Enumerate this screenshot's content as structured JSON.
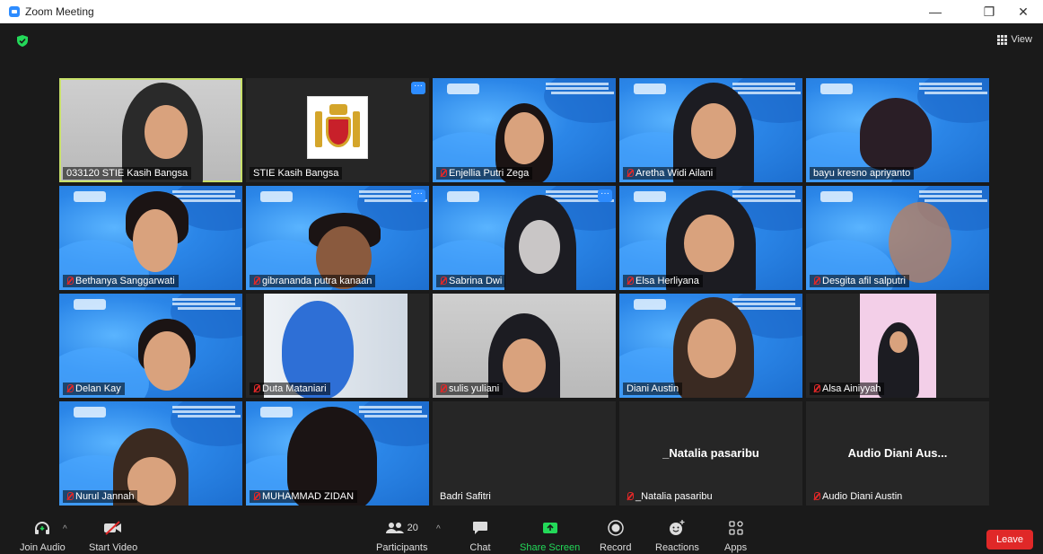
{
  "window": {
    "title": "Zoom Meeting",
    "minimize_glyph": "—",
    "restore_glyph": "❐",
    "close_glyph": "✕"
  },
  "top": {
    "view_label": "View",
    "security_icon": "shield-check-icon"
  },
  "tiles": [
    {
      "name": "033120 STIE Kasih Bangsa",
      "muted": false
    },
    {
      "name": "STIE Kasih Bangsa",
      "muted": false
    },
    {
      "name": "Enjellia Putri Zega",
      "muted": true
    },
    {
      "name": "Aretha Widi Ailani",
      "muted": true
    },
    {
      "name": "bayu kresno apriyanto",
      "muted": false
    },
    {
      "name": "Bethanya Sanggarwati",
      "muted": true
    },
    {
      "name": "gibrananda putra kanaan",
      "muted": true
    },
    {
      "name": "Sabrina Dwi",
      "muted": true
    },
    {
      "name": "Elsa Herliyana",
      "muted": true
    },
    {
      "name": "Desgita afil salputri",
      "muted": true
    },
    {
      "name": "Delan Kay",
      "muted": true
    },
    {
      "name": "Duta Mataniari",
      "muted": true
    },
    {
      "name": "sulis yuliani",
      "muted": true
    },
    {
      "name": "Diani Austin",
      "muted": false
    },
    {
      "name": "Alsa Ainiyyah",
      "muted": true
    },
    {
      "name": "Nurul Jannah",
      "muted": true
    },
    {
      "name": "MUHAMMAD ZIDAN",
      "muted": true
    },
    {
      "name": "Badri Safitri",
      "muted": false
    },
    {
      "name": "_Natalia pasaribu",
      "muted": true,
      "big": "_Natalia pasaribu"
    },
    {
      "name": "Audio Diani Austin",
      "muted": true,
      "big": "Audio Diani Aus..."
    }
  ],
  "toolbar": {
    "join_audio": "Join Audio",
    "start_video": "Start Video",
    "participants": "Participants",
    "participants_count": "20",
    "chat": "Chat",
    "share_screen": "Share Screen",
    "record": "Record",
    "reactions": "Reactions",
    "apps": "Apps",
    "leave": "Leave"
  },
  "colors": {
    "accent_green": "#23d959",
    "leave_red": "#e02828",
    "active_outline": "#c8e06a"
  }
}
